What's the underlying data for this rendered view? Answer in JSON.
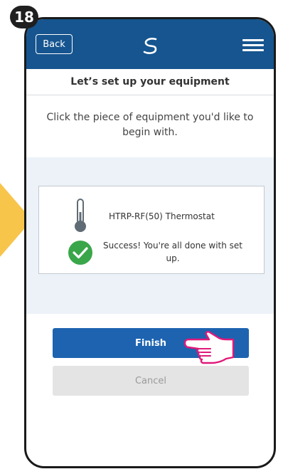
{
  "step": {
    "number": "18"
  },
  "header": {
    "back_label": "Back",
    "logo_icon": "salus-logo-icon",
    "menu_icon": "hamburger-menu-icon",
    "background": "#16558f"
  },
  "page": {
    "title": "Let’s set up your equipment",
    "instruction": "Click the piece of equipment you'd like to begin with."
  },
  "equipment": [
    {
      "icon": "thermometer-icon",
      "name": "HTRP-RF(50) Thermostat",
      "status_icon": "check-circle-icon",
      "status": "Success! You're all done with set up.",
      "status_color": "#3aa64a"
    }
  ],
  "actions": {
    "finish_label": "Finish",
    "cancel_label": "Cancel",
    "accent": "#1d63b0"
  }
}
